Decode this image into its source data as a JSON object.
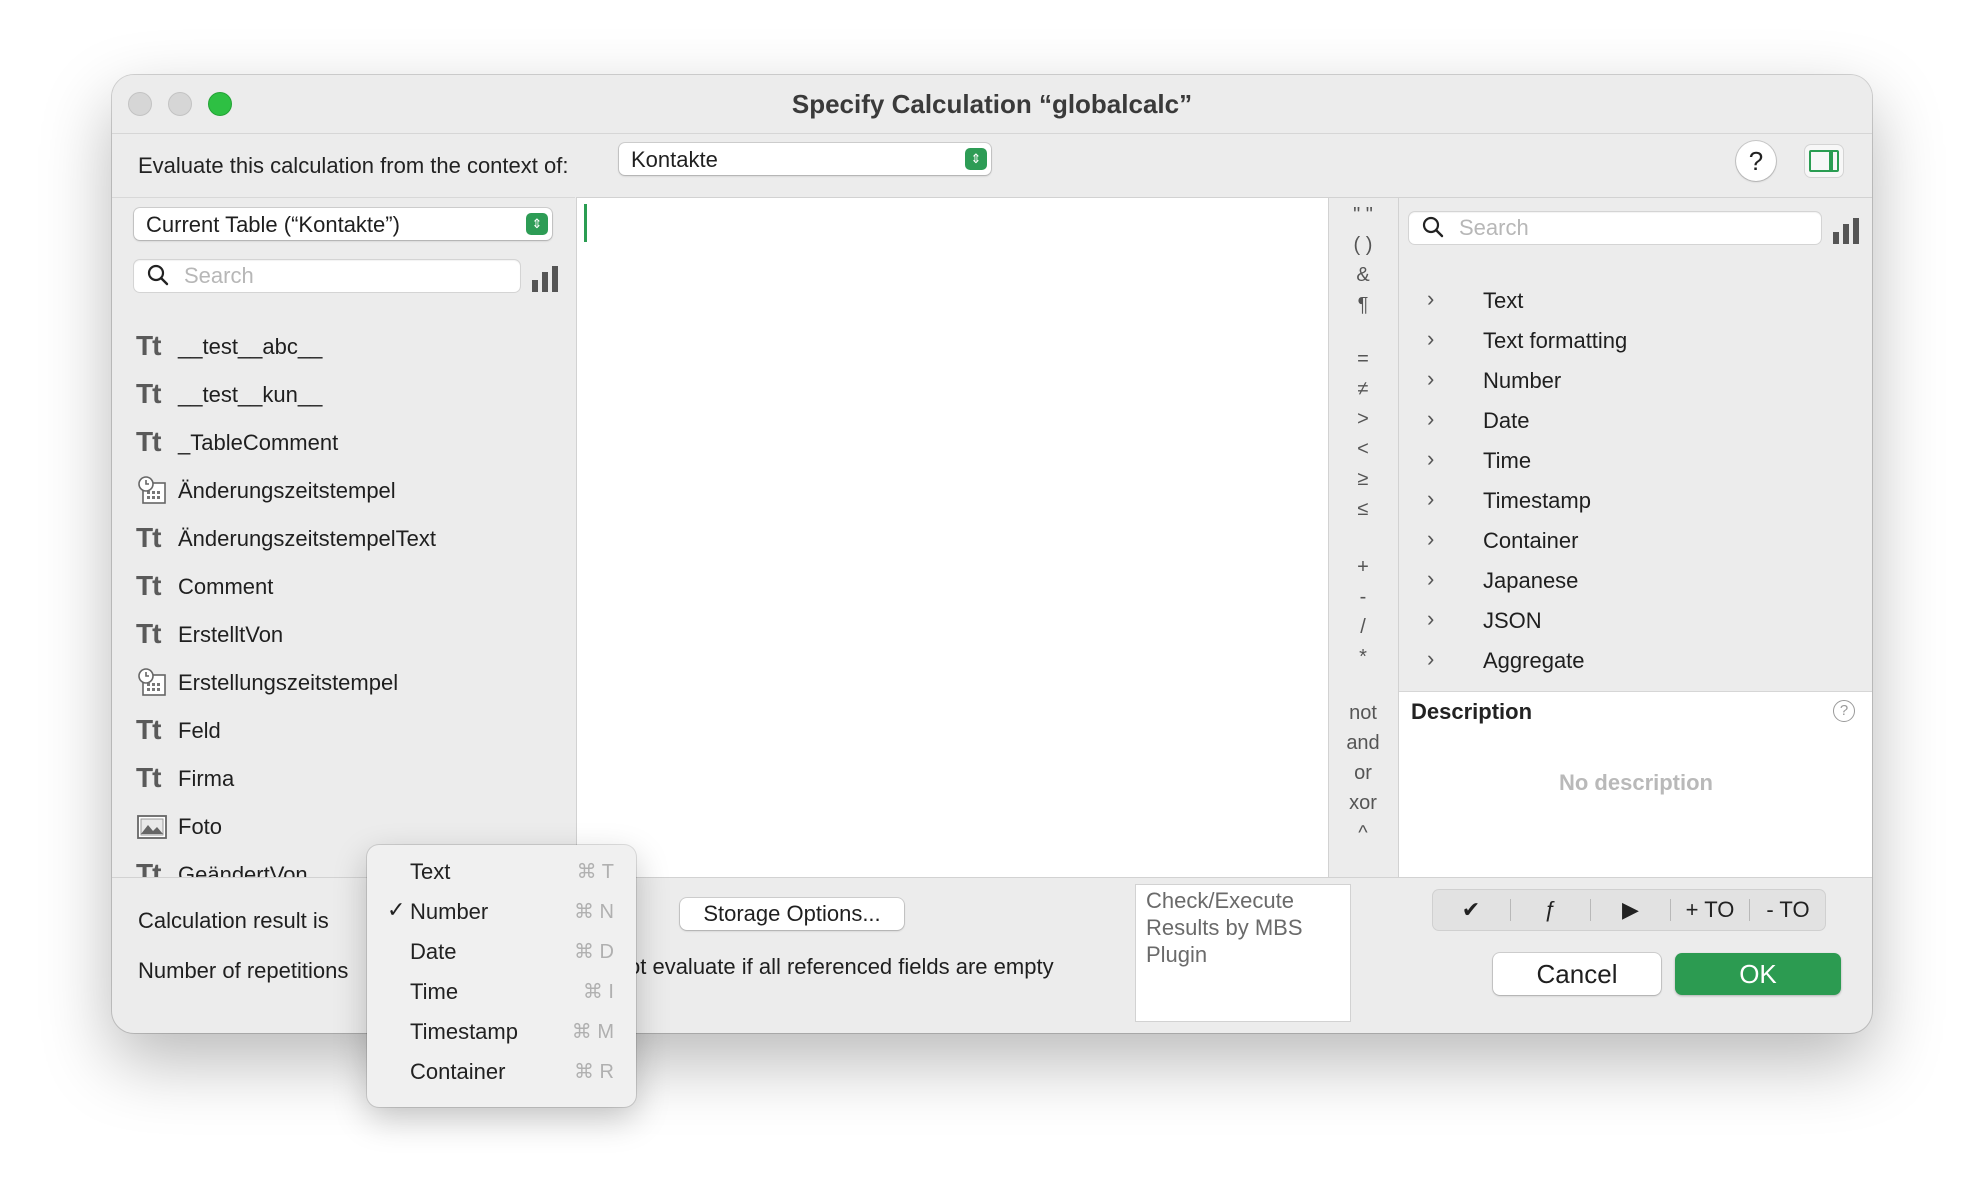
{
  "window": {
    "title": "Specify Calculation “globalcalc”"
  },
  "context": {
    "label": "Evaluate this calculation from the context of:",
    "table_value": "Kontakte",
    "help_label": "?"
  },
  "left": {
    "table_popup": "Current Table (“Kontakte”)",
    "search_placeholder": "Search",
    "fields": [
      {
        "name": "__test__abc__",
        "icon": "text-field-icon"
      },
      {
        "name": "__test__kun__",
        "icon": "text-field-icon"
      },
      {
        "name": "_TableComment",
        "icon": "text-field-icon"
      },
      {
        "name": "Änderungszeitstempel",
        "icon": "timestamp-field-icon"
      },
      {
        "name": "ÄnderungszeitstempelText",
        "icon": "text-field-icon"
      },
      {
        "name": "Comment",
        "icon": "text-field-icon"
      },
      {
        "name": "ErstelltVon",
        "icon": "text-field-icon"
      },
      {
        "name": "Erstellungszeitstempel",
        "icon": "timestamp-field-icon"
      },
      {
        "name": "Feld",
        "icon": "text-field-icon"
      },
      {
        "name": "Firma",
        "icon": "text-field-icon"
      },
      {
        "name": "Foto",
        "icon": "container-field-icon"
      },
      {
        "name": "GeändertVon",
        "icon": "text-field-icon"
      }
    ],
    "text_icon_glyph": "Tt"
  },
  "operators": {
    "top": [
      "\" \"",
      "( )",
      "&",
      "¶"
    ],
    "compare": [
      "=",
      "≠",
      ">",
      "<",
      "≥",
      "≤"
    ],
    "math": [
      "+",
      "-",
      "/",
      "*"
    ],
    "logic": [
      "not",
      "and",
      "or",
      "xor",
      "^"
    ]
  },
  "right": {
    "search_placeholder": "Search",
    "categories": [
      "Text",
      "Text formatting",
      "Number",
      "Date",
      "Time",
      "Timestamp",
      "Container",
      "Japanese",
      "JSON",
      "Aggregate"
    ],
    "description_title": "Description",
    "description_text": "No description",
    "help_glyph": "?"
  },
  "bottom": {
    "result_label": "Calculation result is",
    "repetitions_label": "Number of repetitions",
    "storage_button": "Storage Options...",
    "do_not_evaluate_text": "ot evaluate if all referenced fields are empty",
    "mbs_text": "Check/Execute Results by MBS Plugin",
    "seg_buttons": [
      "✔",
      "ƒ",
      "▶",
      "+ TO",
      "- TO"
    ],
    "cancel": "Cancel",
    "ok": "OK"
  },
  "result_menu": {
    "selected": "Number",
    "items": [
      {
        "label": "Text",
        "shortcut": "⌘ T",
        "checked": ""
      },
      {
        "label": "Number",
        "shortcut": "⌘ N",
        "checked": "✓"
      },
      {
        "label": "Date",
        "shortcut": "⌘ D",
        "checked": ""
      },
      {
        "label": "Time",
        "shortcut": "⌘ I",
        "checked": ""
      },
      {
        "label": "Timestamp",
        "shortcut": "⌘ M",
        "checked": ""
      },
      {
        "label": "Container",
        "shortcut": "⌘ R",
        "checked": ""
      }
    ]
  },
  "colors": {
    "accent_green": "#2c9b51",
    "traffic_green": "#2ec043"
  }
}
